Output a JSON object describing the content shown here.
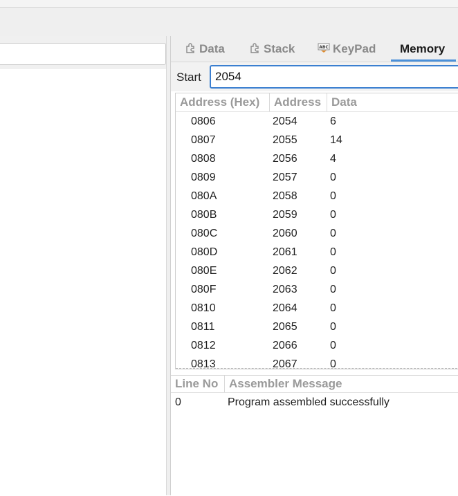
{
  "tabs": [
    {
      "label": "Data",
      "icon": "puzzle-icon",
      "active": false
    },
    {
      "label": "Stack",
      "icon": "puzzle-icon",
      "active": false
    },
    {
      "label": "KeyPad",
      "icon": "abc-keypad-icon",
      "active": false
    },
    {
      "label": "Memory",
      "icon": "",
      "active": true
    }
  ],
  "start": {
    "label": "Start",
    "value": "2054"
  },
  "memory": {
    "headers": {
      "hex": "Address (Hex)",
      "address": "Address",
      "data": "Data"
    },
    "rows": [
      {
        "hex": "0806",
        "address": "2054",
        "data": "6"
      },
      {
        "hex": "0807",
        "address": "2055",
        "data": "14"
      },
      {
        "hex": "0808",
        "address": "2056",
        "data": "4"
      },
      {
        "hex": "0809",
        "address": "2057",
        "data": "0"
      },
      {
        "hex": "080A",
        "address": "2058",
        "data": "0"
      },
      {
        "hex": "080B",
        "address": "2059",
        "data": "0"
      },
      {
        "hex": "080C",
        "address": "2060",
        "data": "0"
      },
      {
        "hex": "080D",
        "address": "2061",
        "data": "0"
      },
      {
        "hex": "080E",
        "address": "2062",
        "data": "0"
      },
      {
        "hex": "080F",
        "address": "2063",
        "data": "0"
      },
      {
        "hex": "0810",
        "address": "2064",
        "data": "0"
      },
      {
        "hex": "0811",
        "address": "2065",
        "data": "0"
      },
      {
        "hex": "0812",
        "address": "2066",
        "data": "0"
      },
      {
        "hex": "0813",
        "address": "2067",
        "data": "0"
      }
    ]
  },
  "messages": {
    "headers": {
      "line": "Line No",
      "message": "Assembler Message"
    },
    "rows": [
      {
        "line": "0",
        "message": "Program assembled successfully"
      }
    ]
  },
  "colors": {
    "accent": "#4a90d9",
    "focus_border": "#3b7fd0",
    "header_text": "#9a9a9a"
  }
}
